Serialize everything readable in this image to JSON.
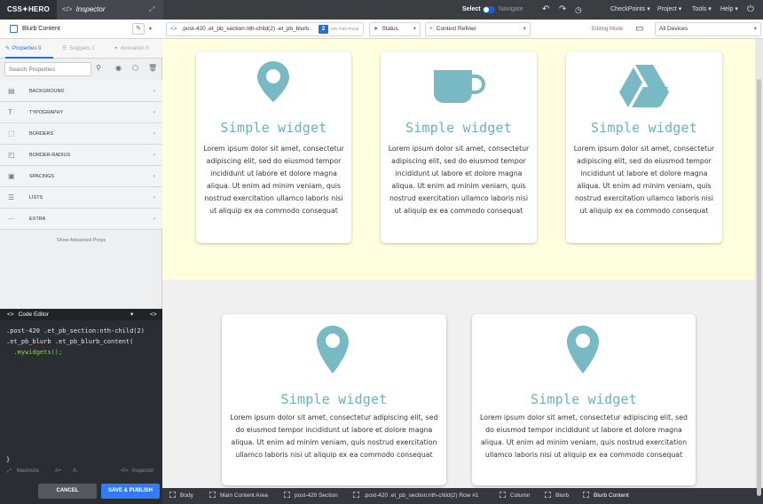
{
  "topbar": {
    "logo": "CSS✦HERO",
    "inspector_label": "Inspector",
    "select_label": "Select",
    "navigate_label": "Navigate",
    "menus": [
      "CheckPoints ▾",
      "Project ▾",
      "Tools ▾",
      "Help ▾"
    ]
  },
  "toolbar": {
    "element_name": "Blurb Content",
    "selector": ".post-420 .et_pb_section:nth-child(2) .et_pb_blurb .",
    "match_count": "2",
    "match_label": "ON THIS PAGE",
    "status_label": "Status",
    "context_refiner_label": "Context Refiner",
    "editing_mode_label": "Editing Mode:",
    "device_label": "All Devices"
  },
  "left_panel": {
    "tabs": [
      {
        "label": "Properties 0"
      },
      {
        "label": "Snippets 1"
      },
      {
        "label": "Animation 0"
      }
    ],
    "search_placeholder": "Search Properties",
    "properties": [
      {
        "label": "BACKGROUND",
        "icon": "background-icon"
      },
      {
        "label": "TYPOGRAPHY",
        "icon": "typography-icon"
      },
      {
        "label": "BORDERS",
        "icon": "borders-icon"
      },
      {
        "label": "BORDER-RADIUS",
        "icon": "border-radius-icon"
      },
      {
        "label": "SPACINGS",
        "icon": "spacings-icon"
      },
      {
        "label": "LISTS",
        "icon": "lists-icon"
      },
      {
        "label": "EXTRA",
        "icon": "extra-icon"
      }
    ],
    "advanced_label": "Show Advanced Props"
  },
  "code_editor": {
    "title": "Code Editor",
    "lines": [
      ".post-420 .et_pb_section:nth-child(2)",
      ".et_pb_blurb .et_pb_blurb_content(",
      "  .mywidgets();",
      "}"
    ],
    "maximize_label": "Maximize",
    "font_up": "A+",
    "font_down": "A-",
    "inspector_label": "Inspector"
  },
  "buttons": {
    "cancel": "CANCEL",
    "save": "SAVE & PUBLISH"
  },
  "breadcrumbs": [
    "Body",
    "Main Content Area",
    "post-420 Section",
    ".post-420 .et_pb_section:nth-child(2) Row #1",
    "Column",
    "Blurb",
    "Blurb Content"
  ],
  "cards": [
    {
      "icon": "location-pin-icon",
      "title": "Simple widget",
      "text": "Lorem ipsum dolor sit amet, consectetur adipiscing elit, sed do eiusmod tempor incididunt ut labore et dolore magna aliqua. Ut enim ad minim veniam, quis nostrud exercitation ullamco laboris nisi ut aliquip ex ea commodo consequat"
    },
    {
      "icon": "coffee-cup-icon",
      "title": "Simple widget",
      "text": "Lorem ipsum dolor sit amet, consectetur adipiscing elit, sed do eiusmod tempor incididunt ut labore et dolore magna aliqua. Ut enim ad minim veniam, quis nostrud exercitation ullamco laboris nisi ut aliquip ex ea commodo consequat"
    },
    {
      "icon": "google-drive-icon",
      "title": "Simple widget",
      "text": "Lorem ipsum dolor sit amet, consectetur adipiscing elit, sed do eiusmod tempor incididunt ut labore et dolore magna aliqua. Ut enim ad minim veniam, quis nostrud exercitation ullamco laboris nisi ut aliquip ex ea commodo consequat"
    },
    {
      "icon": "location-pin-icon",
      "title": "Simple widget",
      "text": "Lorem ipsum dolor sit amet, consectetur adipiscing elit, sed do eiusmod tempor incididunt ut labore et dolore magna aliqua. Ut enim ad minim veniam, quis nostrud exercitation ullamco laboris nisi ut aliquip ex ea commodo consequat"
    },
    {
      "icon": "location-pin-icon",
      "title": "Simple widget",
      "text": "Lorem ipsum dolor sit amet, consectetur adipiscing elit, sed do eiusmod tempor incididunt ut labore et dolore magna aliqua. Ut enim ad minim veniam, quis nostrud exercitation ullamco laboris nisi ut aliquip ex ea commodo consequat"
    }
  ],
  "colors": {
    "accent": "#2b6fd6",
    "icon_teal": "#79b9c3",
    "title_teal": "#6ab1bd",
    "highlight_bg": "#ffffe0",
    "save_button": "#2f7cf6"
  }
}
